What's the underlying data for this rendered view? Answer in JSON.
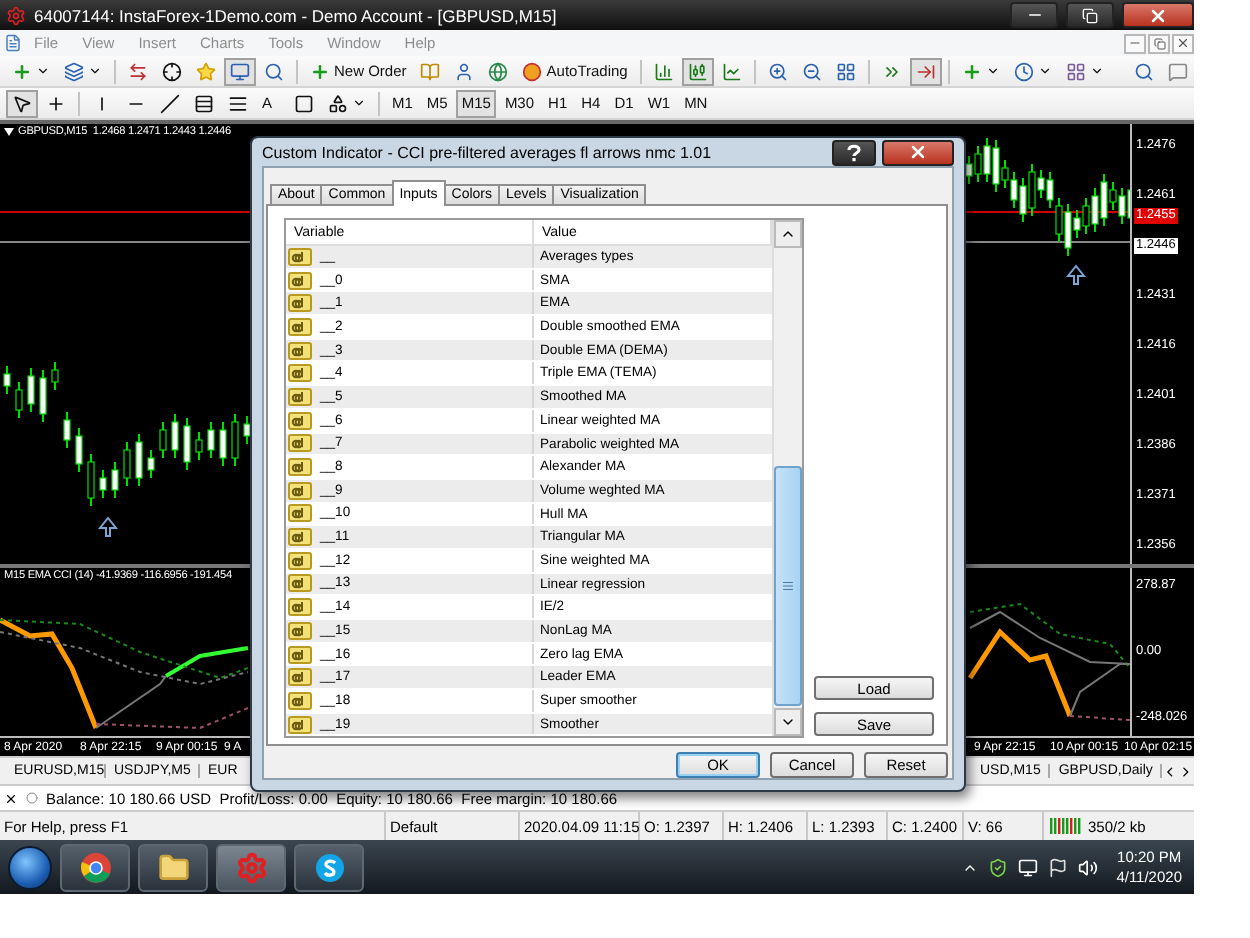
{
  "window": {
    "title": "64007144: InstaForex-1Demo.com - Demo Account - [GBPUSD,M15]"
  },
  "menu": [
    {
      "label": "File",
      "disabled": true
    },
    {
      "label": "View",
      "disabled": true
    },
    {
      "label": "Insert",
      "disabled": true
    },
    {
      "label": "Charts",
      "disabled": true
    },
    {
      "label": "Tools",
      "disabled": true
    },
    {
      "label": "Window",
      "disabled": true
    },
    {
      "label": "Help",
      "disabled": true
    }
  ],
  "toolbar": {
    "new_order": "New Order",
    "auto_trading": "AutoTrading",
    "text_tool": "A"
  },
  "timeframes": [
    {
      "label": "M1",
      "selected": false
    },
    {
      "label": "M5",
      "selected": false
    },
    {
      "label": "M15",
      "selected": true
    },
    {
      "label": "M30",
      "selected": false
    },
    {
      "label": "H1",
      "selected": false
    },
    {
      "label": "H4",
      "selected": false
    },
    {
      "label": "D1",
      "selected": false
    },
    {
      "label": "W1",
      "selected": false
    },
    {
      "label": "MN",
      "selected": false
    }
  ],
  "chart": {
    "symbol": "GBPUSD,M15",
    "ohlc": "1.2468 1.2471 1.2443 1.2446",
    "indicator_legend": "M15 EMA CCI (14) -41.9369 -116.6956 -191.454",
    "price_axis": [
      {
        "label": "1.2476",
        "kind": "tick"
      },
      {
        "label": "1.2461",
        "kind": "tick"
      },
      {
        "label": "1.2455",
        "kind": "ask"
      },
      {
        "label": "1.2446",
        "kind": "bid"
      },
      {
        "label": "1.2431",
        "kind": "tick"
      },
      {
        "label": "1.2416",
        "kind": "tick"
      },
      {
        "label": "1.2401",
        "kind": "tick"
      },
      {
        "label": "1.2386",
        "kind": "tick"
      },
      {
        "label": "1.2371",
        "kind": "tick"
      },
      {
        "label": "1.2356",
        "kind": "tick"
      }
    ],
    "indicator_ticks": [
      "278.87",
      "0.00",
      "-248.026"
    ],
    "time_labels_left": [
      "8 Apr 2020",
      "8 Apr 22:15",
      "9 Apr 00:15",
      "9 A"
    ],
    "time_labels_right": [
      "9 Apr 22:15",
      "10 Apr 00:15",
      "10 Apr 02:15"
    ]
  },
  "dialog": {
    "title": "Custom Indicator - CCI pre-filtered averages fl arrows nmc 1.01",
    "tabs": [
      {
        "label": "About",
        "selected": false
      },
      {
        "label": "Common",
        "selected": false
      },
      {
        "label": "Inputs",
        "selected": true
      },
      {
        "label": "Colors",
        "selected": false
      },
      {
        "label": "Levels",
        "selected": false
      },
      {
        "label": "Visualization",
        "selected": false
      }
    ],
    "columns": [
      "Variable",
      "Value"
    ],
    "rows": [
      {
        "variable": "__",
        "value": "Averages types"
      },
      {
        "variable": "__0",
        "value": "SMA"
      },
      {
        "variable": "__1",
        "value": "EMA"
      },
      {
        "variable": "__2",
        "value": "Double smoothed EMA"
      },
      {
        "variable": "__3",
        "value": "Double EMA (DEMA)"
      },
      {
        "variable": "__4",
        "value": "Triple EMA (TEMA)"
      },
      {
        "variable": "__5",
        "value": "Smoothed MA"
      },
      {
        "variable": "__6",
        "value": "Linear weighted MA"
      },
      {
        "variable": "__7",
        "value": "Parabolic weighted MA"
      },
      {
        "variable": "__8",
        "value": "Alexander MA"
      },
      {
        "variable": "__9",
        "value": "Volume weghted MA"
      },
      {
        "variable": "__10",
        "value": "Hull MA"
      },
      {
        "variable": "__11",
        "value": "Triangular MA"
      },
      {
        "variable": "__12",
        "value": "Sine weighted MA"
      },
      {
        "variable": "__13",
        "value": "Linear regression"
      },
      {
        "variable": "__14",
        "value": "IE/2"
      },
      {
        "variable": "__15",
        "value": "NonLag MA"
      },
      {
        "variable": "__16",
        "value": "Zero lag EMA"
      },
      {
        "variable": "__17",
        "value": "Leader EMA"
      },
      {
        "variable": "__18",
        "value": "Super smoother"
      },
      {
        "variable": "__19",
        "value": "Smoother"
      }
    ],
    "side_buttons": [
      "Load",
      "Save"
    ],
    "buttons": [
      {
        "label": "OK",
        "default": true
      },
      {
        "label": "Cancel",
        "default": false
      },
      {
        "label": "Reset",
        "default": false
      }
    ]
  },
  "chart_tabs": {
    "left": [
      "EURUSD,M15",
      "USDJPY,M5",
      "EUR"
    ],
    "right": [
      "USD,M15",
      "GBPUSD,Daily"
    ]
  },
  "terminal": {
    "balance": "Balance: 10 180.66 USD  Profit/Loss: 0.00  Equity: 10 180.66  Free margin: 10 180.66"
  },
  "status_bar": {
    "cells": [
      "For Help, press F1",
      "Default",
      "2020.04.09 11:15",
      "O: 1.2397",
      "H: 1.2406",
      "L: 1.2393",
      "C: 1.2400",
      "V: 66"
    ],
    "traffic": "350/2 kb"
  },
  "taskbar": {
    "time": "10:20 PM",
    "date": "4/11/2020"
  }
}
